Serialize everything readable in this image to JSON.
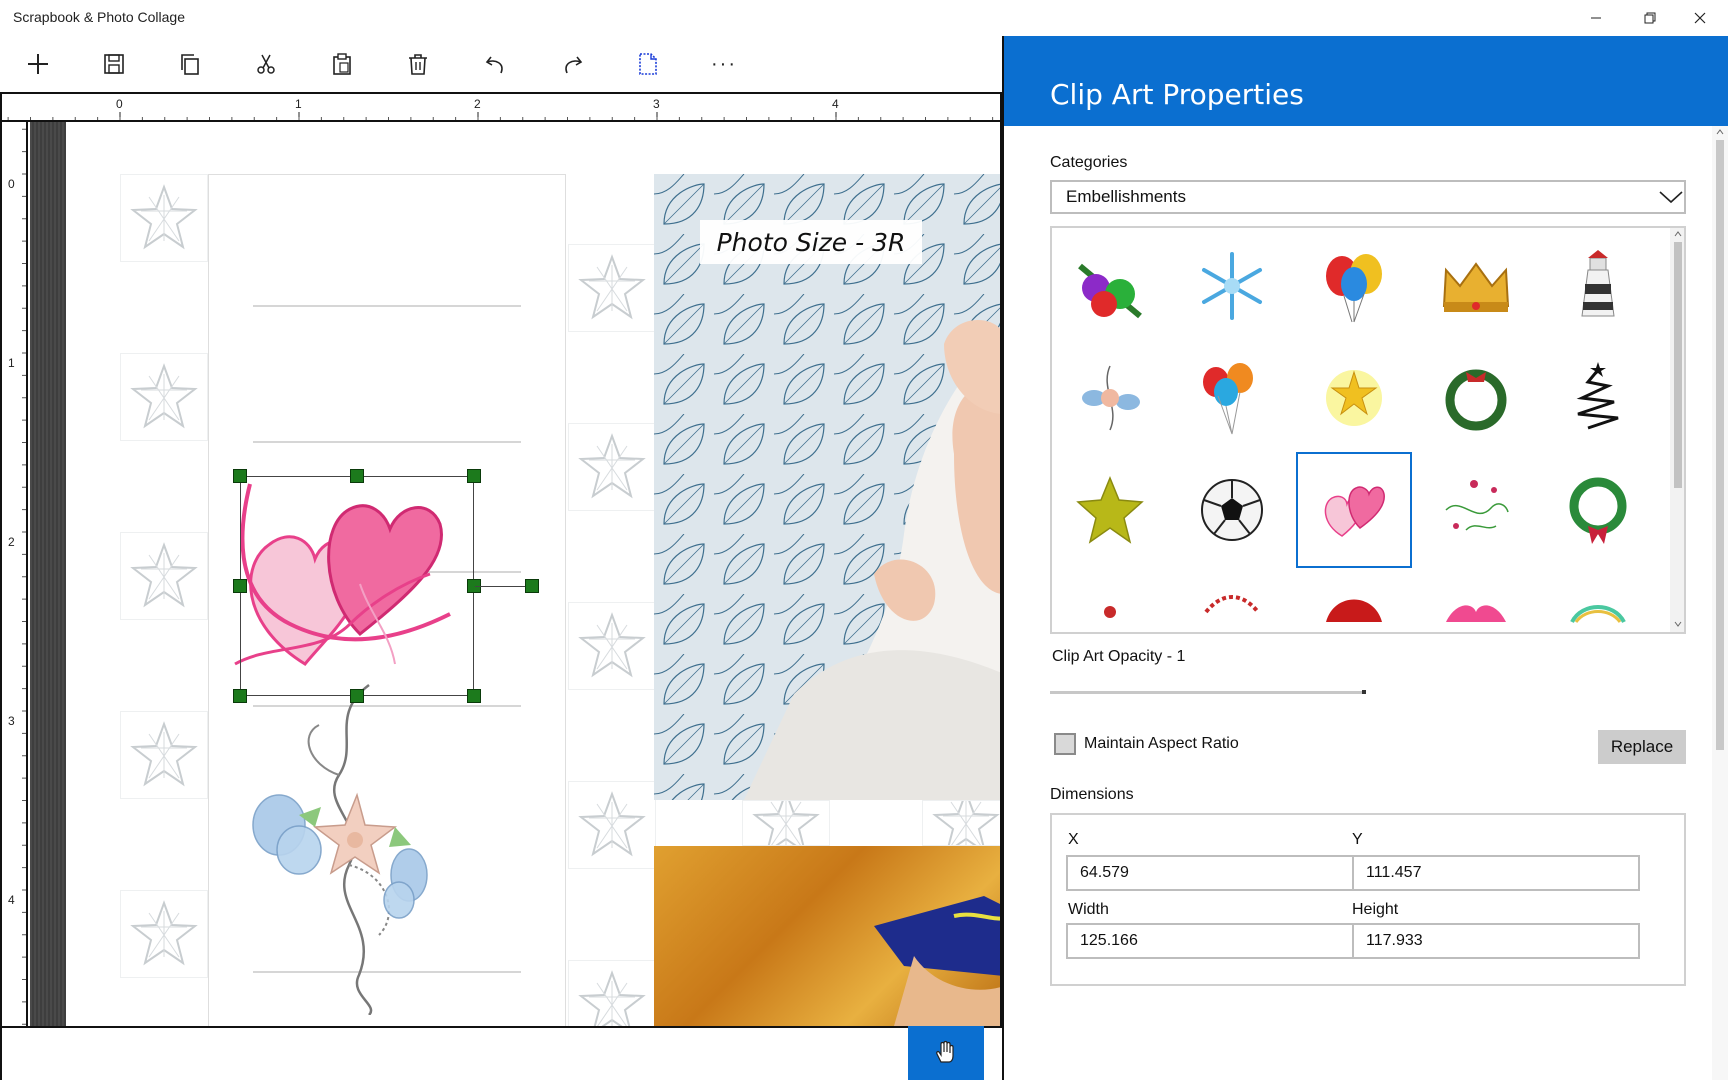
{
  "window": {
    "title": "Scrapbook & Photo Collage"
  },
  "toolbar": {
    "items": [
      "plus-icon",
      "save-icon",
      "copy-icon",
      "cut-icon",
      "paste-icon",
      "delete-icon",
      "undo-icon",
      "redo-icon",
      "page-setup-icon",
      "more-icon"
    ],
    "more_label": "···"
  },
  "rulers": {
    "horizontal": [
      "0",
      "1",
      "2",
      "3",
      "4"
    ],
    "vertical": [
      "0",
      "1",
      "2",
      "3",
      "4"
    ]
  },
  "canvas": {
    "photo_label": "Photo Size - 3R"
  },
  "panel": {
    "title": "Clip Art Properties",
    "categories_label": "Categories",
    "category_value": "Embellishments",
    "clipart_items": [
      "ornaments",
      "snowflake",
      "balloons",
      "crown",
      "lighthouse",
      "floral-spray",
      "balloon-bunch",
      "stars-burst",
      "wreath",
      "swirl-tree",
      "gold-star",
      "soccer-ball",
      "hearts",
      "vine",
      "bow-wreath"
    ],
    "selected_clipart": "hearts",
    "opacity_label": "Clip Art Opacity - 1",
    "opacity_value": 1,
    "aspect_label": "Maintain Aspect Ratio",
    "aspect_checked": false,
    "replace_label": "Replace",
    "dimensions_label": "Dimensions",
    "x_label": "X",
    "x_value": "64.579",
    "y_label": "Y",
    "y_value": "111.457",
    "width_label": "Width",
    "width_value": "125.166",
    "height_label": "Height",
    "height_value": "117.933"
  },
  "colors": {
    "accent": "#0b6fd0",
    "handle": "#1c7a1c",
    "heart": "#e8408a"
  }
}
